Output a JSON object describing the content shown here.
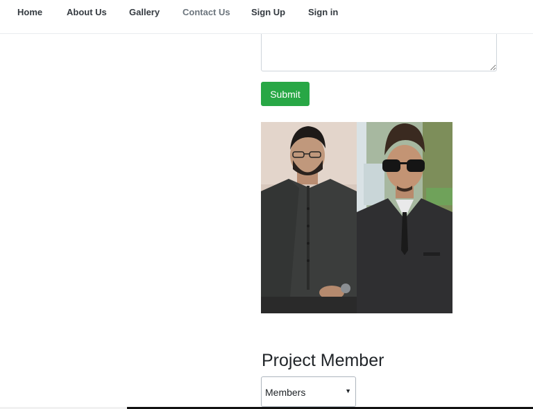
{
  "nav": {
    "items": [
      {
        "label": "Home"
      },
      {
        "label": "About Us"
      },
      {
        "label": "Gallery"
      },
      {
        "label": "Contact Us"
      },
      {
        "label": "Sign Up"
      },
      {
        "label": "Sign in"
      }
    ],
    "active": "Contact Us"
  },
  "form": {
    "message_value": "",
    "submit_label": "Submit"
  },
  "section": {
    "title": "Project Member"
  },
  "members_select": {
    "selected": "Members"
  },
  "colors": {
    "submit_bg": "#28a745",
    "nav_text": "#343a40",
    "nav_active": "#6c757d"
  }
}
